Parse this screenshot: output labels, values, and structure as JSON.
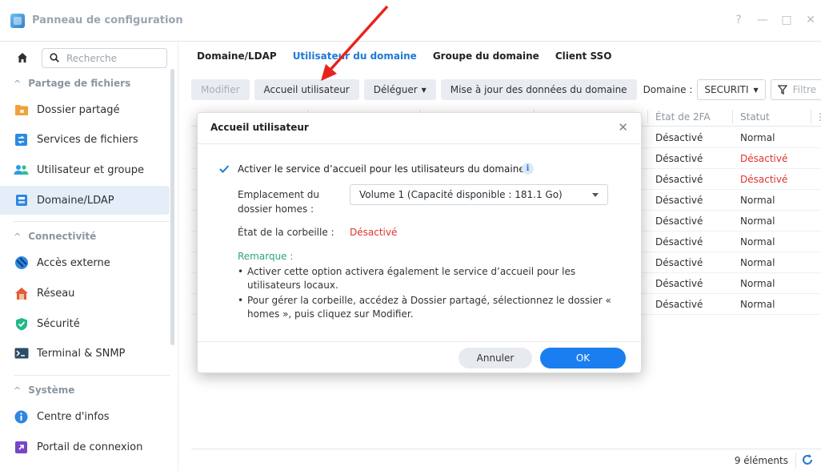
{
  "window": {
    "title": "Panneau de configuration",
    "controls": [
      "?",
      "—",
      "□",
      "✕"
    ]
  },
  "sidebar": {
    "search_placeholder": "Recherche",
    "sections": [
      {
        "label": "Partage de fichiers"
      },
      {
        "label": "Connectivité"
      },
      {
        "label": "Système"
      }
    ],
    "items": [
      {
        "label": "Dossier partagé",
        "icon": "folder-share-icon",
        "color": "#f0a23a"
      },
      {
        "label": "Services de fichiers",
        "icon": "file-services-icon",
        "color": "#2a8ae0"
      },
      {
        "label": "Utilisateur et groupe",
        "icon": "users-icon",
        "color": "#2f9de3"
      },
      {
        "label": "Domaine/LDAP",
        "icon": "domain-icon",
        "color": "#2f86e0"
      },
      {
        "label": "Accès externe",
        "icon": "external-access-icon",
        "color": "#2f86e0"
      },
      {
        "label": "Réseau",
        "icon": "network-icon",
        "color": "#e25c37"
      },
      {
        "label": "Sécurité",
        "icon": "shield-icon",
        "color": "#22b88a"
      },
      {
        "label": "Terminal & SNMP",
        "icon": "terminal-icon",
        "color": "#2e4b66"
      },
      {
        "label": "Centre d'infos",
        "icon": "info-icon",
        "color": "#2f86e0"
      },
      {
        "label": "Portail de connexion",
        "icon": "login-portal-icon",
        "color": "#7a44c7"
      }
    ]
  },
  "tabs": [
    {
      "label": "Domaine/LDAP"
    },
    {
      "label": "Utilisateur du domaine"
    },
    {
      "label": "Groupe du domaine"
    },
    {
      "label": "Client SSO"
    }
  ],
  "toolbar": {
    "modify": "Modifier",
    "home": "Accueil utilisateur",
    "delegate": "Déléguer",
    "update": "Mise à jour des données du domaine",
    "domain_label": "Domaine :",
    "domain_value": "SECURITI",
    "filter_placeholder": "Filtre"
  },
  "table": {
    "headers": [
      "État de 2FA",
      "Statut"
    ],
    "rows": [
      {
        "tfa": "Désactivé",
        "status": "Normal"
      },
      {
        "tfa": "Désactivé",
        "status": "Désactivé"
      },
      {
        "tfa": "Désactivé",
        "status": "Désactivé"
      },
      {
        "tfa": "Désactivé",
        "status": "Normal"
      },
      {
        "tfa": "Désactivé",
        "status": "Normal"
      },
      {
        "tfa": "Désactivé",
        "status": "Normal"
      },
      {
        "tfa": "Désactivé",
        "status": "Normal"
      },
      {
        "tfa": "Désactivé",
        "status": "Normal"
      },
      {
        "tfa": "Désactivé",
        "status": "Normal"
      }
    ],
    "count": "9 éléments"
  },
  "modal": {
    "title": "Accueil utilisateur",
    "checkbox_label": "Activer le service d’accueil pour les utilisateurs du domaine",
    "checkbox_checked": true,
    "location_label": "Emplacement du dossier homes :",
    "location_value": "Volume 1 (Capacité disponible :  181.1 Go)",
    "recycle_label": "État de la corbeille :",
    "recycle_value": "Désactivé",
    "remark_title": "Remarque :",
    "remarks": [
      "Activer cette option activera également le service d’accueil pour les utilisateurs locaux.",
      "Pour gérer la corbeille, accédez à Dossier partagé, sélectionnez le dossier « homes », puis cliquez sur Modifier."
    ],
    "cancel": "Annuler",
    "ok": "OK"
  },
  "colors": {
    "accent": "#1f79d6",
    "danger": "#e0322e",
    "remark": "#2aa67e",
    "annotation_arrow": "#e8231c"
  }
}
